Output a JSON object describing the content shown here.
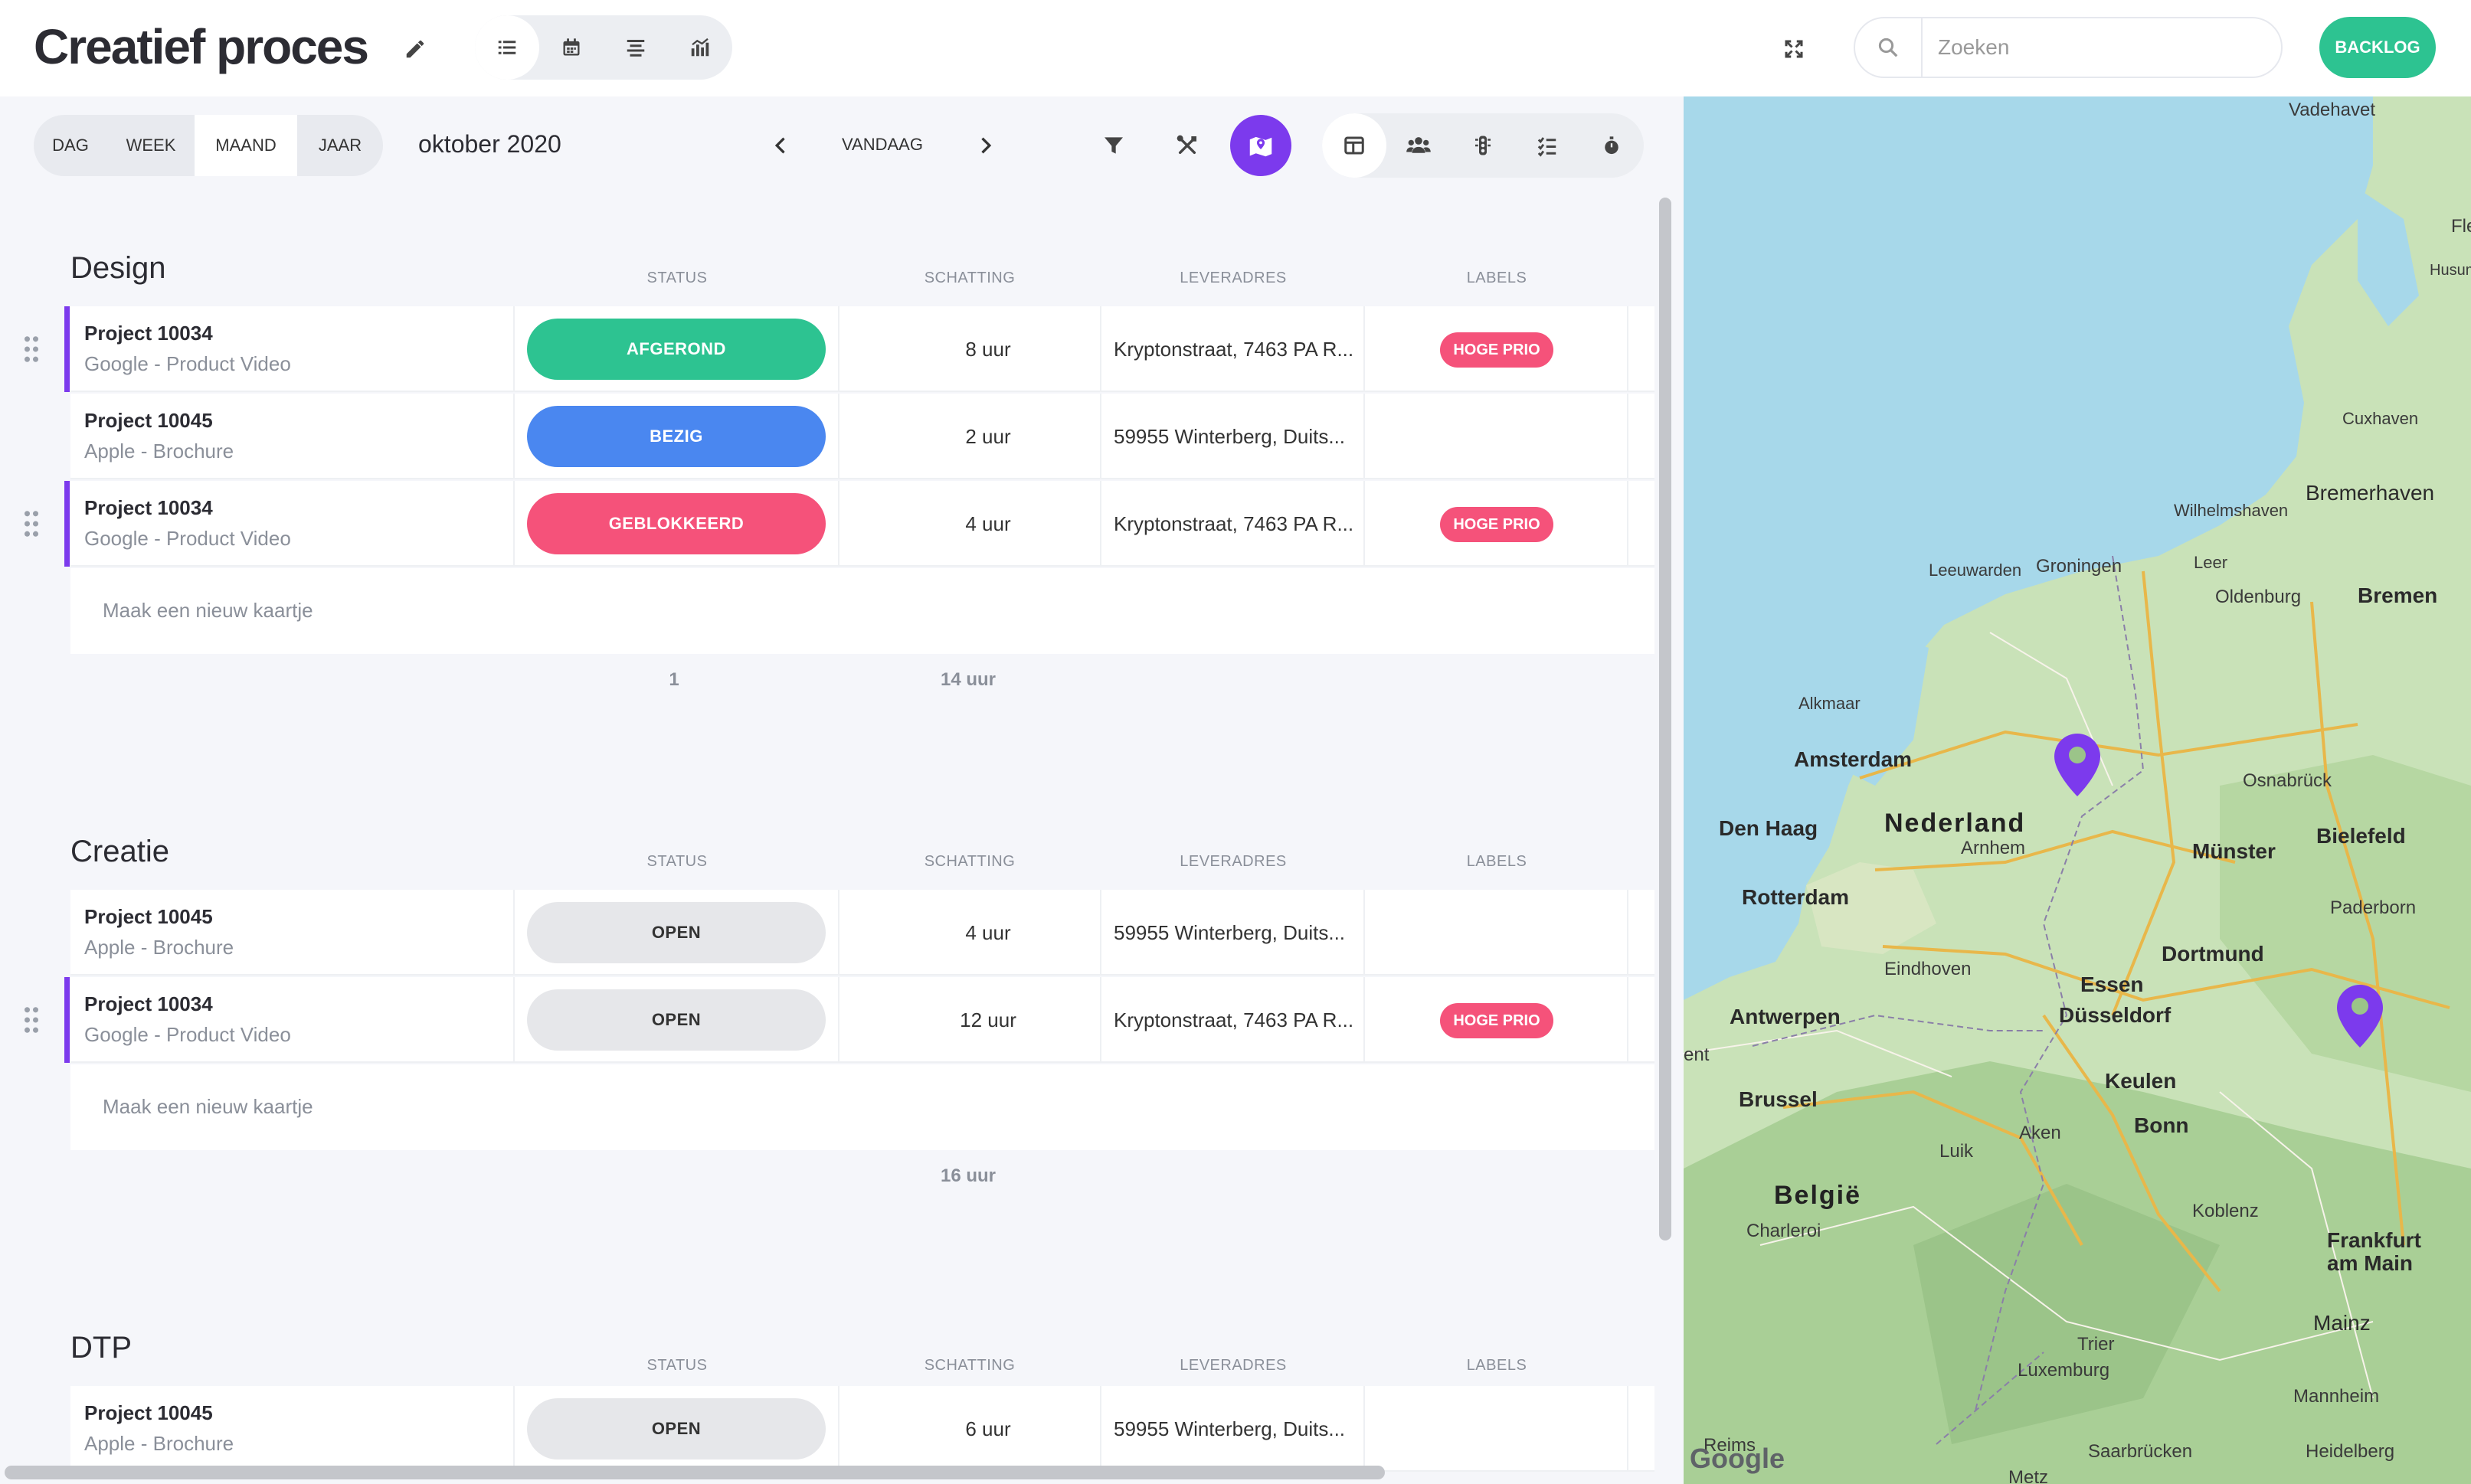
{
  "header": {
    "title": "Creatief proces",
    "search_placeholder": "Zoeken",
    "backlog_label": "BACKLOG"
  },
  "toolbar": {
    "periods": [
      "DAG",
      "WEEK",
      "MAAND",
      "JAAR"
    ],
    "active_period": "MAAND",
    "period_label": "oktober 2020",
    "today_label": "VANDAAG"
  },
  "columns": {
    "status": "STATUS",
    "estimate": "SCHATTING",
    "address": "LEVERADRES",
    "labels": "LABELS"
  },
  "new_card_label": "Maak een nieuw kaartje",
  "groups": [
    {
      "title": "Design",
      "rows": [
        {
          "project": "Project 10034",
          "client": "Google - Product Video",
          "status": "AFGEROND",
          "estimate": "8 uur",
          "address": "Kryptonstraat, 7463 PA R...",
          "label": "HOGE PRIO"
        },
        {
          "project": "Project 10045",
          "client": "Apple - Brochure",
          "status": "BEZIG",
          "estimate": "2 uur",
          "address": "59955 Winterberg, Duits...",
          "label": ""
        },
        {
          "project": "Project 10034",
          "client": "Google - Product Video",
          "status": "GEBLOKKEERD",
          "estimate": "4 uur",
          "address": "Kryptonstraat, 7463 PA R...",
          "label": "HOGE PRIO"
        }
      ],
      "summary_count": "1",
      "summary_estimate": "14 uur"
    },
    {
      "title": "Creatie",
      "rows": [
        {
          "project": "Project 10045",
          "client": "Apple - Brochure",
          "status": "OPEN",
          "estimate": "4 uur",
          "address": "59955 Winterberg, Duits...",
          "label": ""
        },
        {
          "project": "Project 10034",
          "client": "Google - Product Video",
          "status": "OPEN",
          "estimate": "12 uur",
          "address": "Kryptonstraat, 7463 PA R...",
          "label": "HOGE PRIO"
        }
      ],
      "summary_estimate": "16 uur"
    },
    {
      "title": "DTP",
      "rows": [
        {
          "project": "Project 10045",
          "client": "Apple - Brochure",
          "status": "OPEN",
          "estimate": "6 uur",
          "address": "59955 Winterberg, Duits...",
          "label": ""
        }
      ]
    }
  ],
  "status_colors": {
    "AFGEROND": "#2dc391",
    "BEZIG": "#4a87f0",
    "GEBLOKKEERD": "#f5527a",
    "OPEN": "#e6e7ea"
  },
  "accent_color": "#7c3aed",
  "map": {
    "places": [
      "Vadehavet",
      "Fle",
      "Husum",
      "Cuxhaven",
      "Bremerhaven",
      "Wilhelmshaven",
      "Leeuwarden",
      "Groningen",
      "Leer",
      "Oldenburg",
      "Bremen",
      "Alkmaar",
      "Amsterdam",
      "Osnabrück",
      "Den Haag",
      "Nederland",
      "Arnhem",
      "Münster",
      "Bielefeld",
      "Rotterdam",
      "Paderborn",
      "Eindhoven",
      "Dortmund",
      "Essen",
      "Antwerpen",
      "Düsseldorf",
      "ent",
      "Keulen",
      "Brussel",
      "Bonn",
      "Aken",
      "Luik",
      "België",
      "Koblenz",
      "Charleroi",
      "Frankfurt",
      "am Main",
      "Mainz",
      "Trier",
      "Luxemburg",
      "Mannheim",
      "Reims",
      "Saarbrücken",
      "Heidelberg",
      "Metz"
    ],
    "attribution": "Google"
  }
}
